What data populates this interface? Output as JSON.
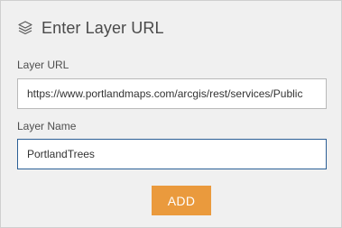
{
  "header": {
    "icon": "layers-icon",
    "title": "Enter Layer URL"
  },
  "form": {
    "url_label": "Layer URL",
    "url_value": "https://www.portlandmaps.com/arcgis/rest/services/Public",
    "name_label": "Layer Name",
    "name_value": "PortlandTrees",
    "add_label": "ADD"
  },
  "colors": {
    "panel_background": "#f0f0f0",
    "accent_button": "#ea9a3d",
    "focused_border": "#2b5f96"
  }
}
